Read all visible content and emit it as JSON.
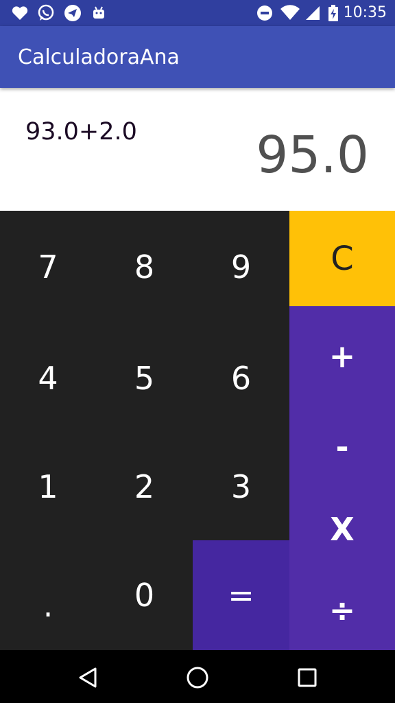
{
  "status_bar": {
    "time": "10:35",
    "left_icons": [
      "heart-icon",
      "whatsapp-icon",
      "telegram-icon",
      "android-icon"
    ],
    "right_icons": [
      "do-not-disturb-icon",
      "wifi-icon",
      "signal-icon",
      "battery-charging-icon"
    ]
  },
  "app_bar": {
    "title": "CalculadoraAna",
    "color": "#3F51B5"
  },
  "display": {
    "expression": "93.0+2.0",
    "result": "95.0"
  },
  "keys": {
    "seven": "7",
    "eight": "8",
    "nine": "9",
    "four": "4",
    "five": "5",
    "six": "6",
    "one": "1",
    "two": "2",
    "three": "3",
    "dot": ".",
    "zero": "0",
    "equals": "=",
    "clear": "C",
    "plus": "+",
    "minus": "-",
    "multiply": "X",
    "divide": "÷"
  },
  "colors": {
    "numpad": "#212121",
    "operators": "#512DA8",
    "equals": "#4527A0",
    "clear": "#FFC107"
  },
  "nav_bar": {
    "icons": [
      "back-icon",
      "home-icon",
      "recents-icon"
    ]
  }
}
